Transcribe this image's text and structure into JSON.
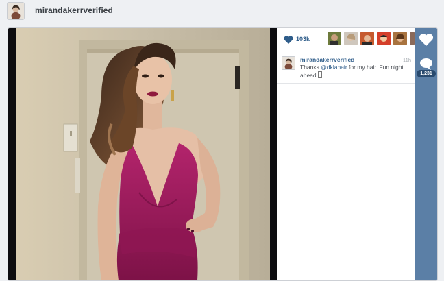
{
  "header": {
    "username": "mirandakerrverified"
  },
  "post": {
    "likes": "103k",
    "comment": {
      "username": "mirandakerrverified",
      "time": "11h",
      "text_before": "Thanks ",
      "mention": "@dklahair",
      "text_after": " for my hair. Fun night ahead "
    },
    "comment_count": "1,231"
  },
  "colors": {
    "link": "#2f5d8a",
    "action_bar": "#5b7fa6",
    "dress": "#9c1a5e"
  },
  "icons": [
    "heart-icon",
    "comment-bubble-icon",
    "caret-down-icon"
  ]
}
